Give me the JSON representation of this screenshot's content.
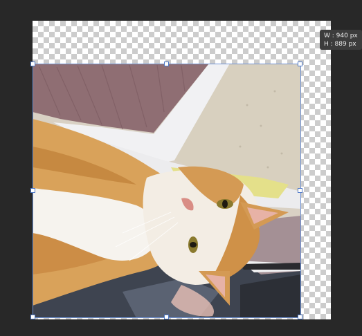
{
  "transform_readout": {
    "width_label": "W :",
    "width_value": "940 px",
    "height_label": "H :",
    "height_value": "889 px"
  },
  "canvas": {
    "transparency_colors": [
      "#ffffff",
      "#cccccc"
    ],
    "background_color": "#282828",
    "selection_color": "#6f93d6"
  },
  "layer": {
    "content": "photo of an orange and white cat lying on a bed"
  }
}
